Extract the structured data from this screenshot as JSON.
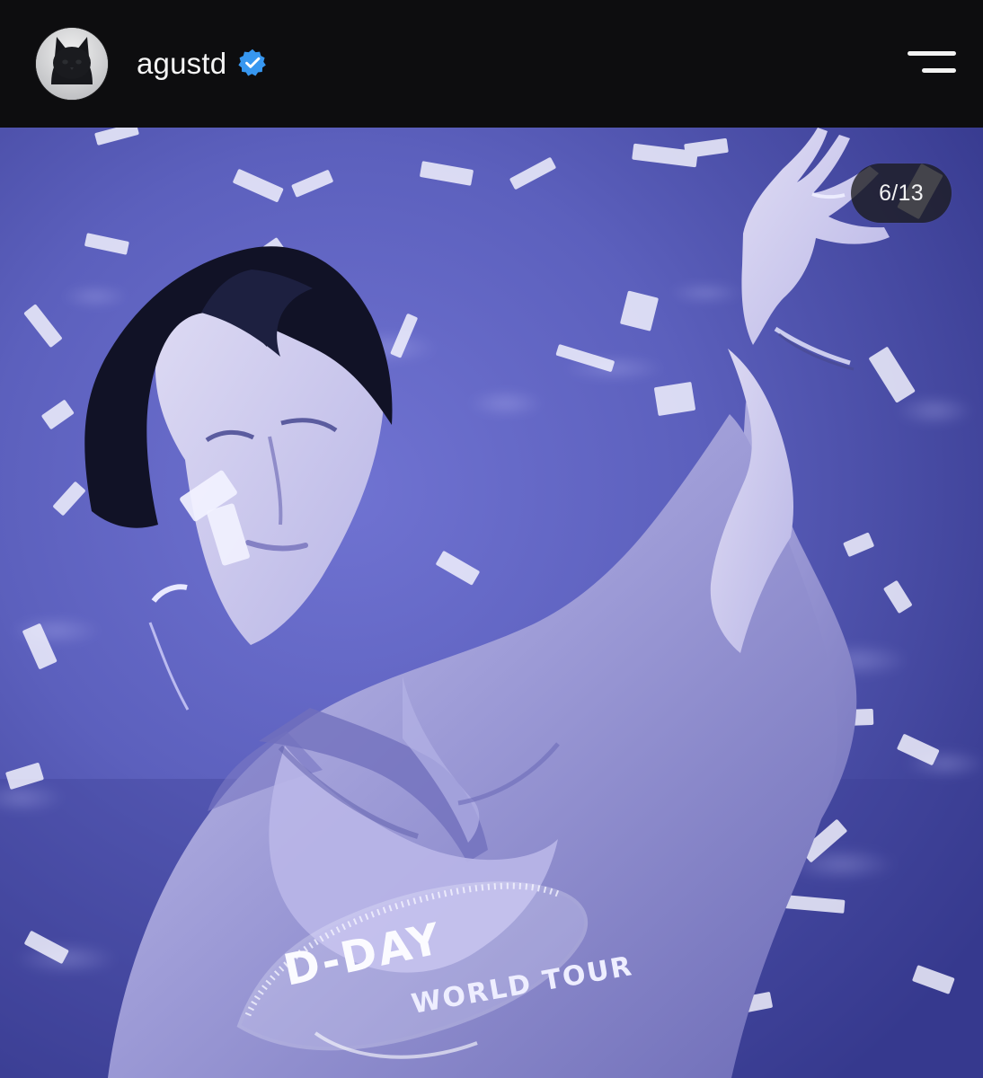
{
  "header": {
    "username": "agustd",
    "icons": {
      "avatar": "black-cat-avatar",
      "verified": "verified-badge-icon",
      "menu": "hamburger-menu-icon"
    }
  },
  "post": {
    "slide_counter": "6/13",
    "graphic_text": {
      "front_arc": "D-DAY",
      "tour_arc": "WORLD TOUR"
    }
  },
  "colors": {
    "header_background": "#0d0d0f",
    "photo_tint": "#5b5eb9",
    "verified_blue": "#3797f0",
    "text_light": "#f4f4f4"
  }
}
